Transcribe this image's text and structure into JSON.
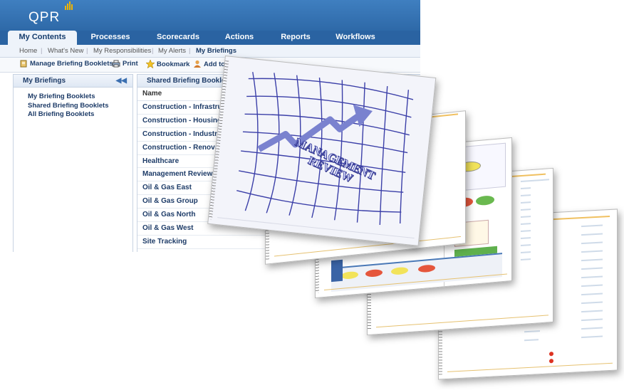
{
  "app": {
    "logo": "QPR",
    "tabs": [
      "My Contents",
      "Processes",
      "Scorecards",
      "Actions",
      "Reports",
      "Workflows"
    ],
    "subnav": [
      "Home",
      "What's New",
      "My Responsibilities",
      "My Alerts",
      "My Briefings"
    ],
    "toolbar": {
      "manage": "Manage Briefing Booklets",
      "print": "Print",
      "bookmark": "Bookmark",
      "add": "Add to B"
    },
    "left_panel": {
      "title": "My Briefings",
      "items": [
        "My Briefing Booklets",
        "Shared Briefing Booklets",
        "All Briefing Booklets"
      ]
    },
    "right_panel": {
      "title": "Shared Briefing Booklets",
      "column": "Name",
      "rows": [
        "Construction - Infrastructure C",
        "Construction - Housing Constr",
        "Construction - Industrial Cons",
        "Construction - Renovation Co",
        "Healthcare",
        "Management Review",
        "Oil & Gas East",
        "Oil & Gas Group",
        "Oil & Gas North",
        "Oil & Gas West",
        "Site Tracking"
      ]
    }
  },
  "slide": {
    "title_line1": "MANAGEMENT",
    "title_line2": "REVIEW"
  },
  "colors": {
    "header": "#2e69a8",
    "accent": "#f0b400",
    "arrow": "#6a74c9"
  }
}
